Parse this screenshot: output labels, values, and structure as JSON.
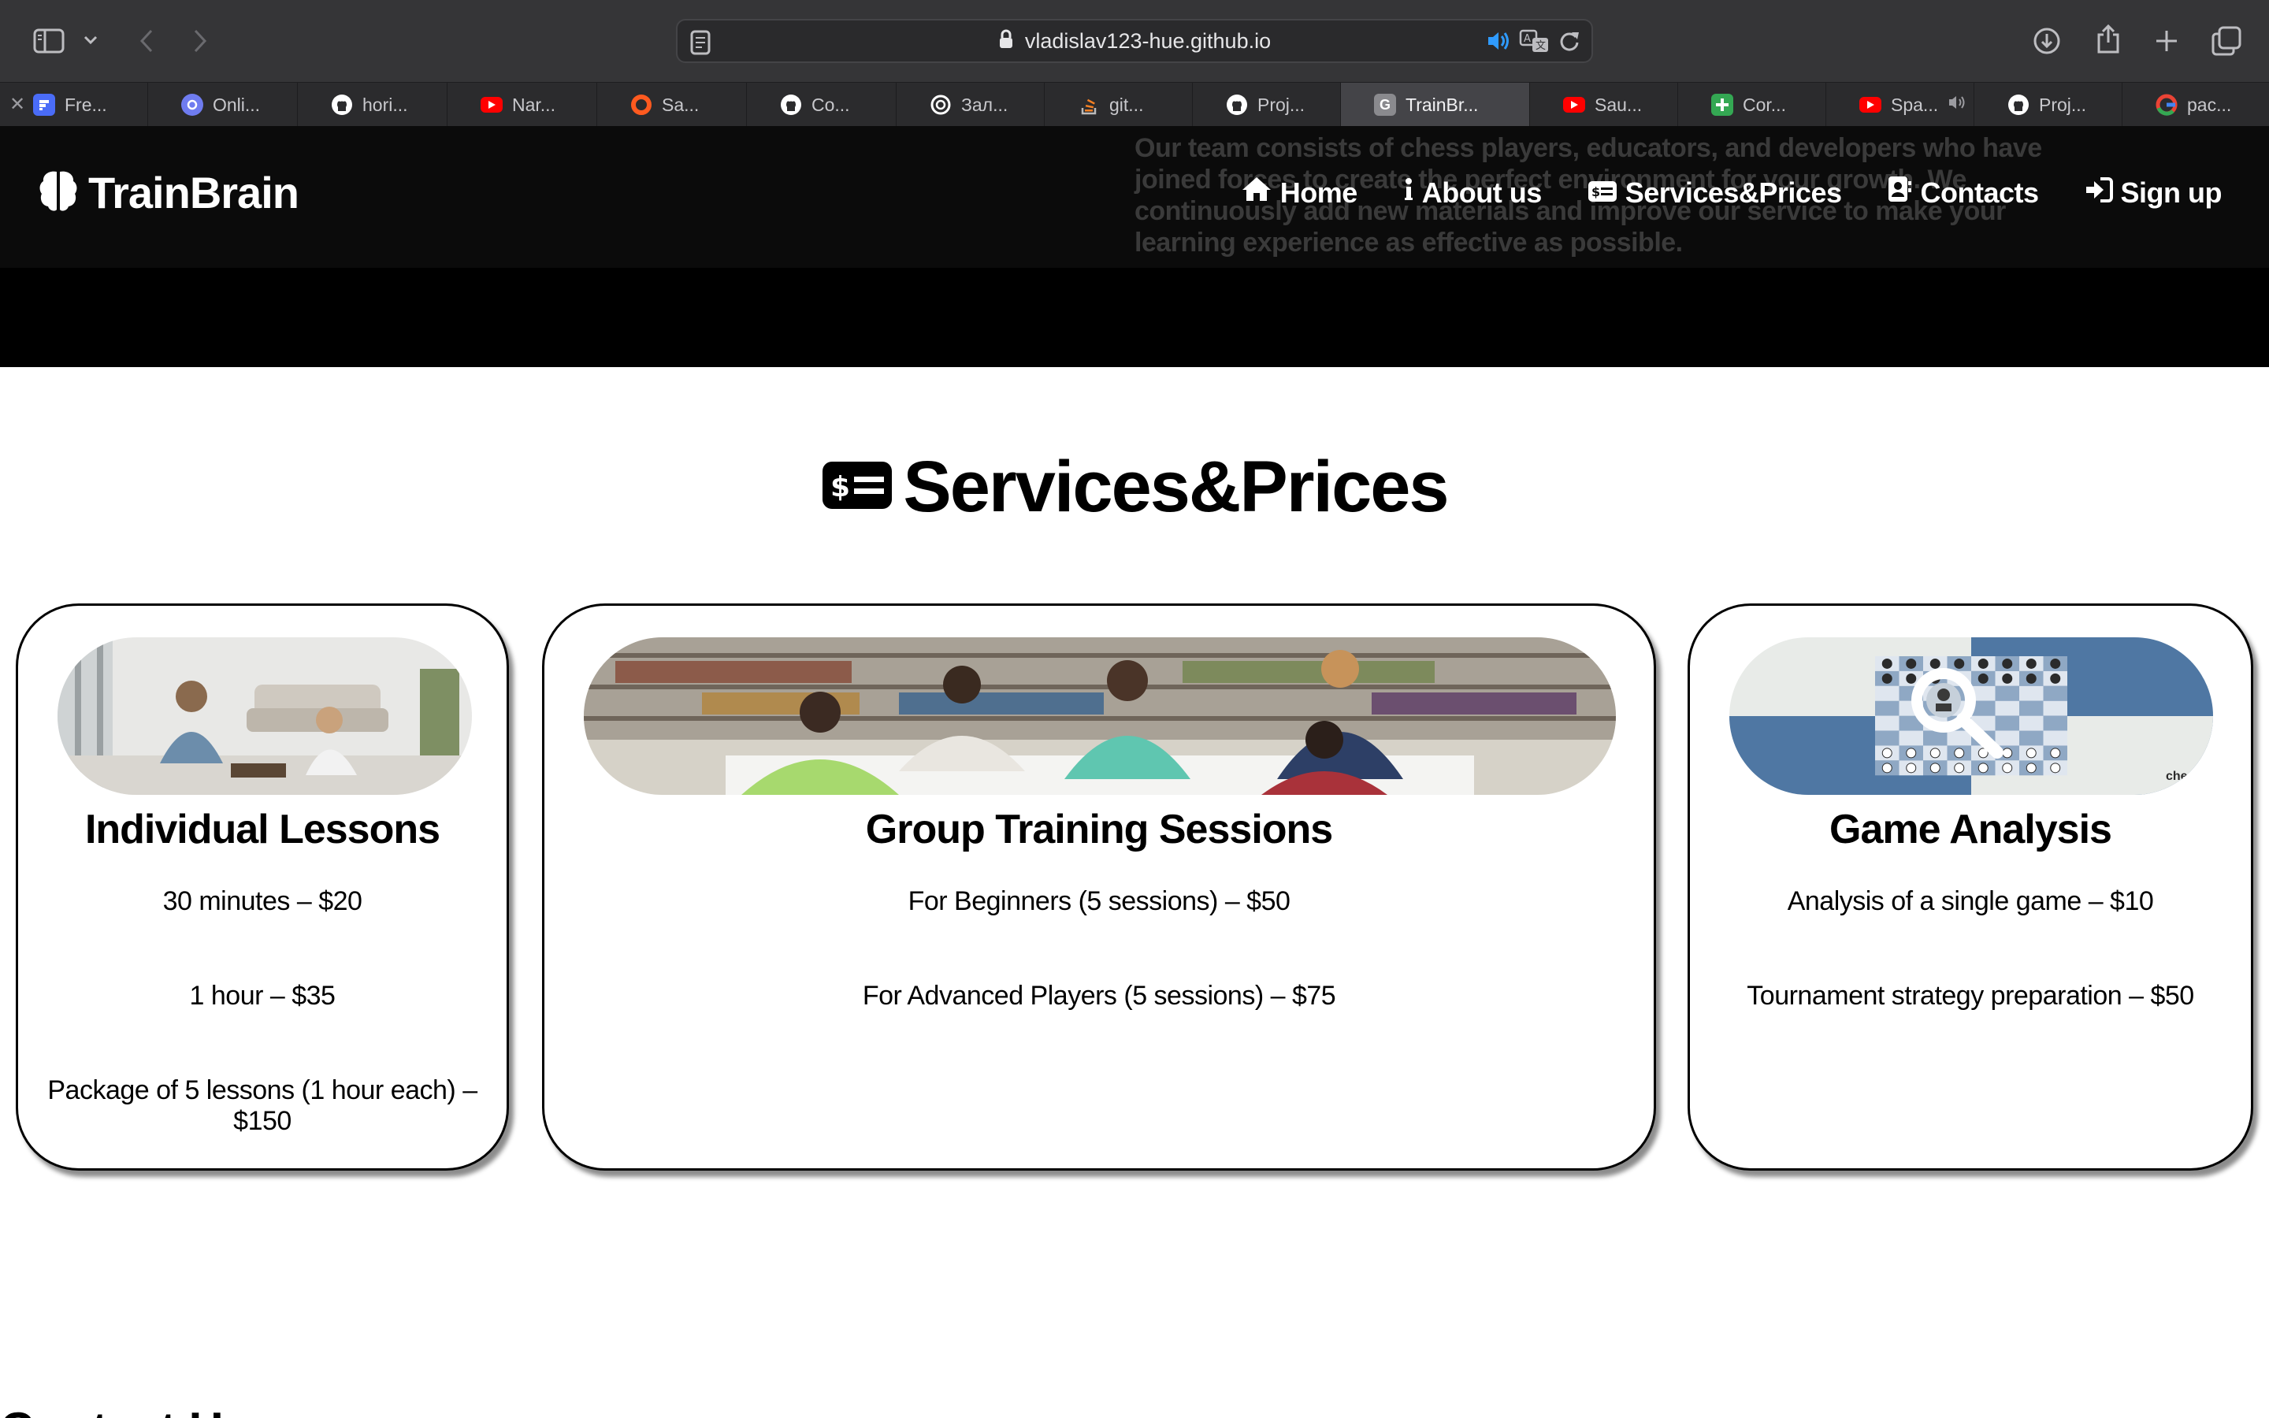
{
  "browser": {
    "url": "vladislav123-hue.github.io",
    "tabs": [
      {
        "label": "Fre...",
        "icon": "framer-icon",
        "color": "#4a6cf7"
      },
      {
        "label": "Onli...",
        "icon": "online-icon",
        "color": "#6f7cf0"
      },
      {
        "label": "hori...",
        "icon": "github-icon",
        "color": "#ffffff"
      },
      {
        "label": "Nar...",
        "icon": "youtube-icon",
        "color": "#ff0000"
      },
      {
        "label": "Sa...",
        "icon": "circle-icon",
        "color": "#ff5a1f"
      },
      {
        "label": "Co...",
        "icon": "github-icon",
        "color": "#ffffff"
      },
      {
        "label": "Зал...",
        "icon": "openai-icon",
        "color": "#ffffff"
      },
      {
        "label": "git...",
        "icon": "stackoverflow-icon",
        "color": "#f48024"
      },
      {
        "label": "Proj...",
        "icon": "github-icon",
        "color": "#ffffff"
      },
      {
        "label": "TrainBr...",
        "icon": "g-icon",
        "color": "#8a8a8e"
      },
      {
        "label": "Sau...",
        "icon": "youtube-icon",
        "color": "#ff0000"
      },
      {
        "label": "Cor...",
        "icon": "sheets-plus-icon",
        "color": "#34a853"
      },
      {
        "label": "Spa...",
        "icon": "youtube-icon",
        "color": "#ff0000"
      },
      {
        "label": "Proj...",
        "icon": "github-icon",
        "color": "#ffffff"
      },
      {
        "label": "pac...",
        "icon": "google-icon",
        "color": "#4285f4"
      }
    ],
    "active_tab": 9
  },
  "site": {
    "logo": "TrainBrain",
    "overlay_text": "Our team consists of chess players, educators, and developers who have joined forces to create the perfect environment for your growth. We continuously add new materials and improve our service to make your learning experience as effective as possible.",
    "nav": {
      "home": "Home",
      "about": "About us",
      "services": "Services&Prices",
      "contacts": "Contacts",
      "signup": "Sign up"
    }
  },
  "services": {
    "title": "Services&Prices",
    "cards": [
      {
        "title": "Individual Lessons",
        "prices": [
          "30 minutes – $20",
          "1 hour – $35",
          "Package of 5 lessons (1 hour each) – $150"
        ]
      },
      {
        "title": "Group Training Sessions",
        "prices": [
          "For Beginners (5 sessions) – $50",
          "For Advanced Players (5 sessions) – $75"
        ]
      },
      {
        "title": "Game Analysis",
        "prices": [
          "Analysis of a single game – $10",
          "Tournament strategy preparation – $50"
        ],
        "image_text": "chess"
      }
    ]
  },
  "bottom_heading": "Contact Us"
}
